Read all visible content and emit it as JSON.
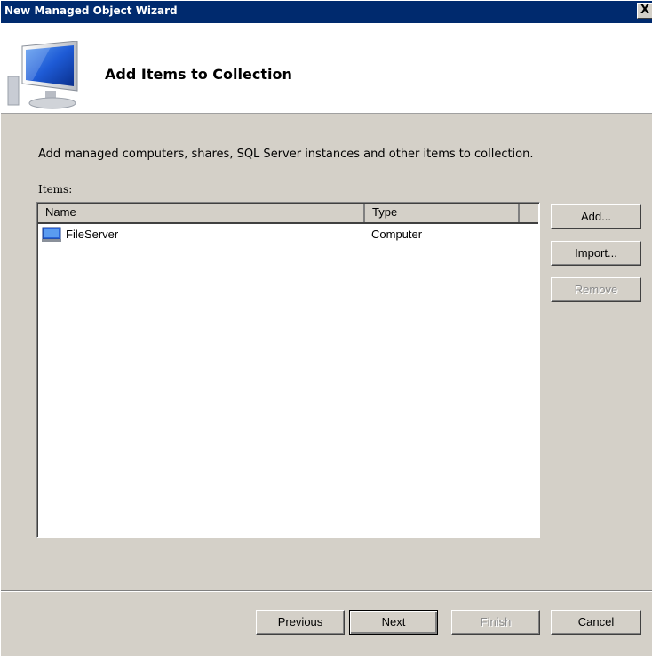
{
  "window": {
    "title": "New Managed Object Wizard",
    "close_label": "X"
  },
  "header": {
    "title": "Add Items to Collection",
    "icon": "computer-monitor-icon"
  },
  "main": {
    "description": "Add managed computers, shares, SQL Server instances and other items to collection.",
    "items_label": "Items:",
    "columns": [
      "Name",
      "Type"
    ],
    "rows": [
      {
        "name": "FileServer",
        "type": "Computer",
        "icon": "computer-icon"
      }
    ]
  },
  "side_buttons": {
    "add": "Add...",
    "import": "Import...",
    "remove": "Remove"
  },
  "footer": {
    "previous": "Previous",
    "next": "Next",
    "finish": "Finish",
    "cancel": "Cancel"
  }
}
